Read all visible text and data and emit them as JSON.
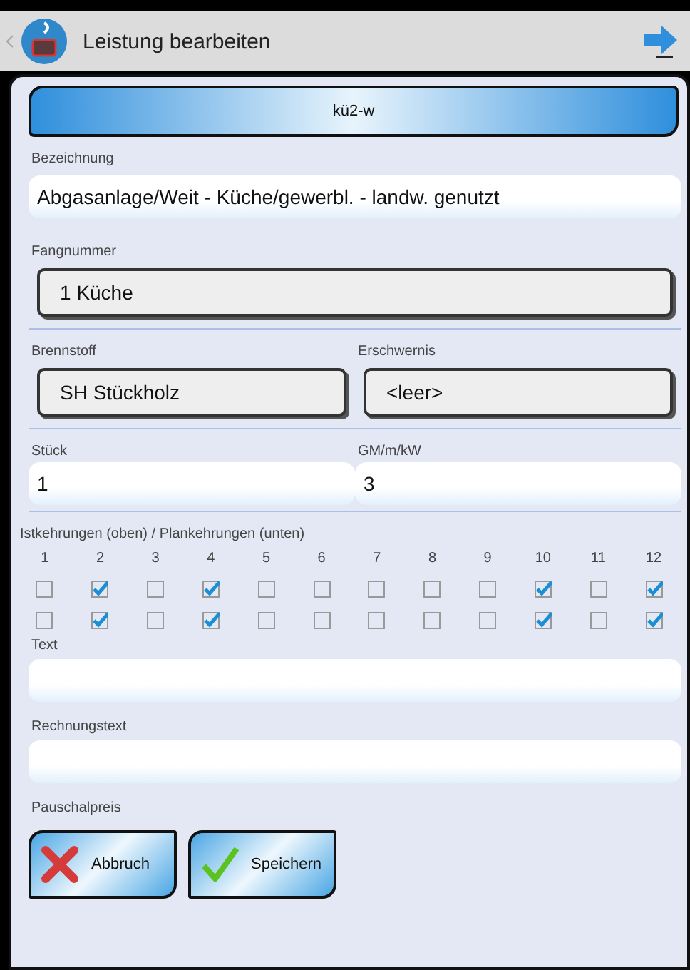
{
  "header": {
    "title": "Leistung bearbeiten"
  },
  "banner": {
    "label": "kü2-w"
  },
  "bezeichnung": {
    "label": "Bezeichnung",
    "value": "Abgasanlage/Weit - Küche/gewerbl. - landw. genutzt"
  },
  "fangnummer": {
    "label": "Fangnummer",
    "code": "1",
    "name": "Küche"
  },
  "brennstoff": {
    "label": "Brennstoff",
    "code": "SH",
    "name": "Stückholz"
  },
  "erschwernis": {
    "label": "Erschwernis",
    "value": "<leer>"
  },
  "stueck": {
    "label": "Stück",
    "value": "1"
  },
  "gm": {
    "label": "GM/m/kW",
    "value": "3"
  },
  "kehrungen": {
    "label": "Istkehrungen (oben) / Plankehrungen (unten)",
    "columns": [
      {
        "number": "1",
        "ist": false,
        "plan": false
      },
      {
        "number": "2",
        "ist": true,
        "plan": true
      },
      {
        "number": "3",
        "ist": false,
        "plan": false
      },
      {
        "number": "4",
        "ist": true,
        "plan": true
      },
      {
        "number": "5",
        "ist": false,
        "plan": false
      },
      {
        "number": "6",
        "ist": false,
        "plan": false
      },
      {
        "number": "7",
        "ist": false,
        "plan": false
      },
      {
        "number": "8",
        "ist": false,
        "plan": false
      },
      {
        "number": "9",
        "ist": false,
        "plan": false
      },
      {
        "number": "10",
        "ist": true,
        "plan": true
      },
      {
        "number": "11",
        "ist": false,
        "plan": false
      },
      {
        "number": "12",
        "ist": true,
        "plan": true
      }
    ]
  },
  "text": {
    "label": "Text"
  },
  "rechnungstext": {
    "label": "Rechnungstext"
  },
  "pauschalpreis": {
    "label": "Pauschalpreis"
  },
  "buttons": [
    {
      "kind": "cancel",
      "label": "Abbruch"
    },
    {
      "kind": "save",
      "label": "Speichern"
    }
  ]
}
